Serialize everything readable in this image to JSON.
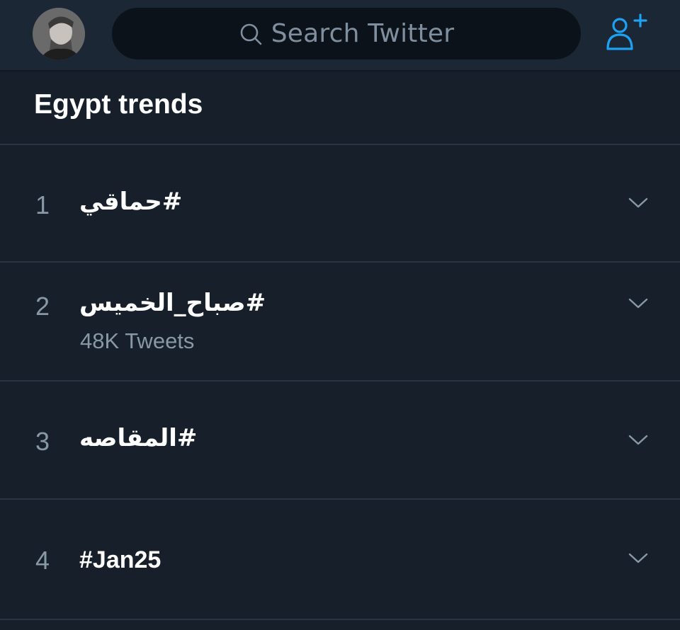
{
  "header": {
    "search_placeholder": "Search Twitter",
    "icons": {
      "avatar": "profile-avatar",
      "search": "search-icon",
      "add_user": "add-user-icon"
    },
    "accent_color": "#1da1f2"
  },
  "trends": {
    "title": "Egypt trends",
    "items": [
      {
        "rank": "1",
        "hashtag": "#حماقي",
        "tweets": ""
      },
      {
        "rank": "2",
        "hashtag": "#صباح_الخميس",
        "tweets": "48K Tweets"
      },
      {
        "rank": "3",
        "hashtag": "#المقاصه",
        "tweets": ""
      },
      {
        "rank": "4",
        "hashtag": "#Jan25",
        "tweets": ""
      }
    ]
  }
}
